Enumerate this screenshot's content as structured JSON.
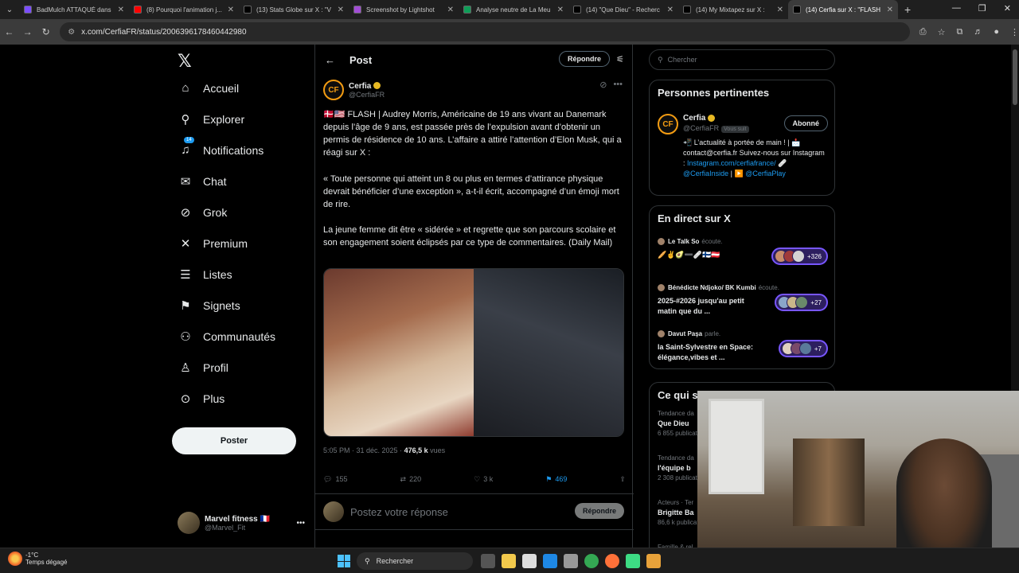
{
  "browser": {
    "tabs": [
      {
        "label": "BadMulch ATTAQUÉ dans",
        "color": "#7b4dff"
      },
      {
        "label": "(8) Pourquoi l'animation j...",
        "color": "#ff0000"
      },
      {
        "label": "(13) Stats Globe sur X : \"V",
        "color": "#000000"
      },
      {
        "label": "Screenshot by Lightshot",
        "color": "#a24dd6"
      },
      {
        "label": "Analyse neutre de La Meu",
        "color": "#0f9d58"
      },
      {
        "label": "(14) \"Que Dieu\" - Recherc",
        "color": "#000000"
      },
      {
        "label": "(14) My Mixtapez sur X : ",
        "color": "#000000"
      },
      {
        "label": "(14) Cerfia sur X : \"FLASH",
        "color": "#000000",
        "active": true
      }
    ],
    "url": "x.com/CerfiaFR/status/2006396178460442980"
  },
  "nav": {
    "items": [
      {
        "label": "Accueil",
        "icon": "home-icon",
        "glyph": "⌂"
      },
      {
        "label": "Explorer",
        "icon": "search-icon",
        "glyph": "⚲"
      },
      {
        "label": "Notifications",
        "icon": "bell-icon",
        "glyph": "♫",
        "badge": "14"
      },
      {
        "label": "Chat",
        "icon": "mail-icon",
        "glyph": "✉"
      },
      {
        "label": "Grok",
        "icon": "grok-icon",
        "glyph": "⊘"
      },
      {
        "label": "Premium",
        "icon": "x-premium-icon",
        "glyph": "✕"
      },
      {
        "label": "Listes",
        "icon": "list-icon",
        "glyph": "☰"
      },
      {
        "label": "Signets",
        "icon": "bookmark-icon",
        "glyph": "⚑"
      },
      {
        "label": "Communautés",
        "icon": "communities-icon",
        "glyph": "⚇"
      },
      {
        "label": "Profil",
        "icon": "profile-icon",
        "glyph": "♙"
      },
      {
        "label": "Plus",
        "icon": "more-circle-icon",
        "glyph": "⊙"
      }
    ],
    "post_label": "Poster",
    "account": {
      "name": "Marvel fitness 🇫🇷",
      "handle": "@Marvel_Fit"
    }
  },
  "post": {
    "header_title": "Post",
    "reply_top": "Répondre",
    "author_name": "Cerfia",
    "author_handle": "@CerfiaFR",
    "para1": "🇩🇰🇺🇸 FLASH | Audrey Morris, Américaine de 19 ans vivant au Danemark depuis l’âge de 9 ans, est passée près de l’expulsion avant d’obtenir un permis de résidence de 10 ans. L’affaire a attiré l’attention d’Elon Musk, qui a réagi sur X :",
    "para2": "« Toute personne qui atteint un 8 ou plus en termes d’attirance physique devrait bénéficier d’une exception », a-t-il écrit, accompagné d’un émoji mort de rire.",
    "para3": "La jeune femme dit être « sidérée » et regrette que son parcours scolaire et son engagement soient éclipsés par ce type de commentaires. (Daily Mail)",
    "time": "5:05 PM · 31 déc. 2025 · ",
    "views_num": "476,5 k",
    "views_label": " vues",
    "replies": "155",
    "reposts": "220",
    "likes": "3 k",
    "bookmarks": "469",
    "reply_placeholder": "Postez votre réponse",
    "reply_button": "Répondre"
  },
  "sidebar": {
    "search_placeholder": "Chercher",
    "relevant_title": "Personnes pertinentes",
    "relevant": {
      "name": "Cerfia",
      "handle": "@CerfiaFR",
      "follows_you": "Vous suit",
      "button": "Abonné",
      "bio_line1": "📲 L’actualité à portée de main ! | 📩 contact@cerfia.fr Suivez-nous sur Instagram :",
      "bio_link1": "Instagram.com/cerfiafrance/",
      "bio_sep": " 🩹 ",
      "bio_link2": "@CerfiaInside",
      "bio_mid": " | ▶️ ",
      "bio_link3": "@CerfiaPlay"
    },
    "live_title": "En direct sur X",
    "live": [
      {
        "host": "Le Talk So",
        "action": "écoute.",
        "title": "🥖✌️🥑➖🩹🇫🇮🇦🇹",
        "count": "+326"
      },
      {
        "host": "Bénédicte Ndjoko/ BK Kumbi",
        "action": "écoute.",
        "title": "2025-#2026 jusqu'au petit matin que du ...",
        "count": "+27"
      },
      {
        "host": "Davut Paşa",
        "action": "parle.",
        "title": "la Saint-Sylvestre en Space: élégance,vibes et ...",
        "count": "+7"
      }
    ],
    "happening_title": "Ce qui se passe",
    "trends": [
      {
        "meta": "Tendance da",
        "name": "Que Dieu",
        "count": "6 855 publicatio"
      },
      {
        "meta": "Tendance da",
        "name": "l'équipe b",
        "count": "2 308 publicatio"
      },
      {
        "meta": "Acteurs · Ter",
        "name": "Brigitte Ba",
        "count": "86,6 k publicatio"
      },
      {
        "meta": "Famille & rel",
        "name": "",
        "count": ""
      }
    ]
  },
  "taskbar": {
    "temp": "-1°C",
    "weather": "Temps dégagé",
    "search": "Rechercher"
  }
}
